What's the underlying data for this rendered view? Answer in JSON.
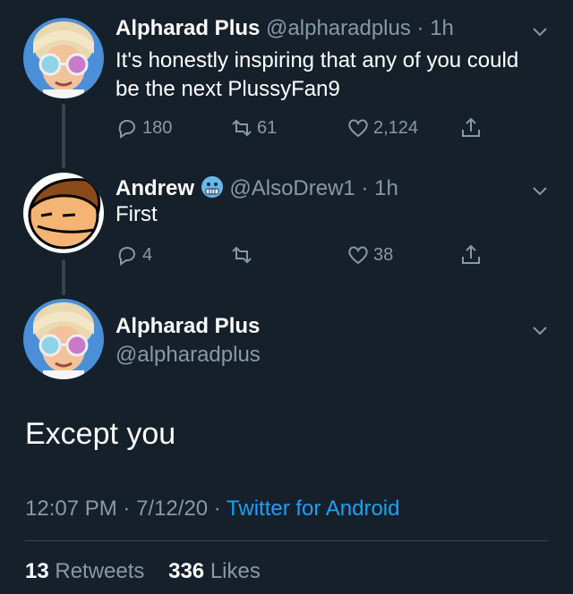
{
  "tweet1": {
    "name": "Alpharad Plus",
    "handle": "@alpharadplus",
    "time": "1h",
    "text": "It's honestly inspiring that any of you could be the next PlussyFan9",
    "replies": "180",
    "retweets": "61",
    "likes": "2,124"
  },
  "tweet2": {
    "name": "Andrew",
    "handle": "@AlsoDrew1",
    "time": "1h",
    "text": "First",
    "replies": "4",
    "retweets": "",
    "likes": "38"
  },
  "tweet3": {
    "name": "Alpharad Plus",
    "handle": "@alpharadplus",
    "text": "Except you",
    "time": "12:07 PM",
    "date": "7/12/20",
    "source": "Twitter for Android",
    "retweet_count": "13",
    "retweet_label": "Retweets",
    "like_count": "336",
    "like_label": "Likes"
  },
  "icons": {
    "reply": "reply-icon",
    "retweet": "retweet-icon",
    "like": "heart-icon",
    "share": "share-icon",
    "more": "chevron-down-icon",
    "emoji": "cold-face-emoji-icon"
  },
  "colors": {
    "background": "#15202b",
    "muted": "#8899a6",
    "accent": "#1da1f2",
    "line": "#38444d"
  }
}
